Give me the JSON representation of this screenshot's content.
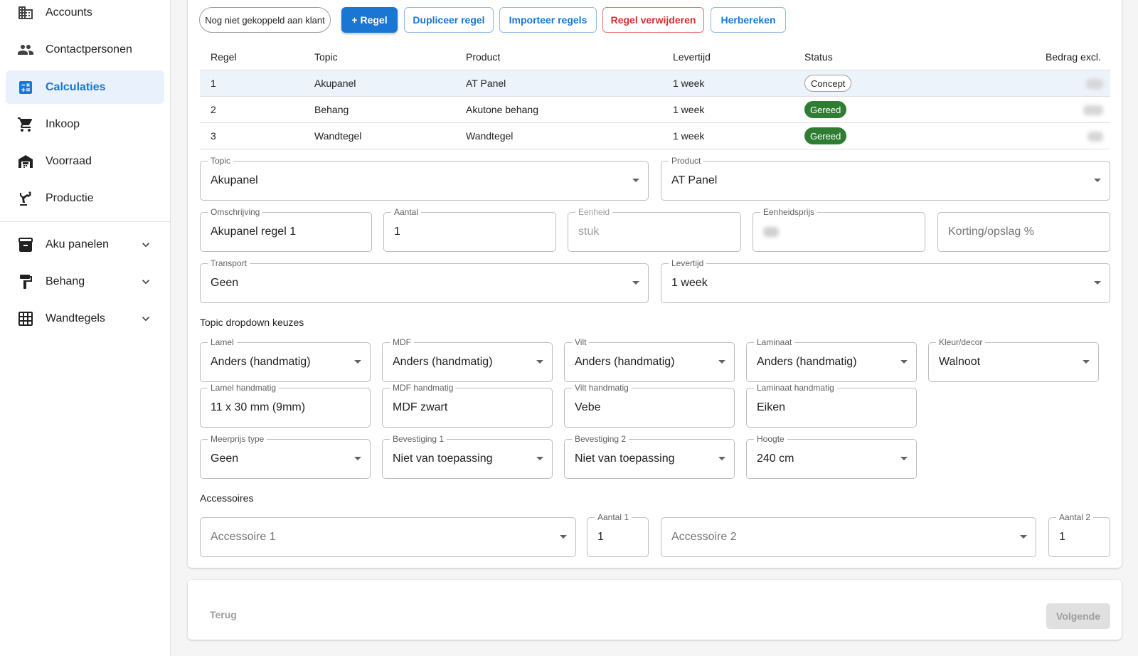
{
  "sidebar": {
    "items": [
      {
        "label": "Accounts",
        "icon": "building-icon"
      },
      {
        "label": "Contactpersonen",
        "icon": "people-icon"
      },
      {
        "label": "Calculaties",
        "icon": "calculator-icon",
        "active": true
      },
      {
        "label": "Inkoop",
        "icon": "cart-icon"
      },
      {
        "label": "Voorraad",
        "icon": "warehouse-icon"
      },
      {
        "label": "Productie",
        "icon": "robot-arm-icon"
      }
    ],
    "groups": [
      {
        "label": "Aku panelen",
        "icon": "archive-box-icon"
      },
      {
        "label": "Behang",
        "icon": "paint-roller-icon"
      },
      {
        "label": "Wandtegels",
        "icon": "grid-icon"
      }
    ]
  },
  "toolbar": {
    "customer_chip": "Nog niet gekoppeld aan klant",
    "add_rule": "+ Regel",
    "duplicate_rule": "Dupliceer regel",
    "import_rules": "Importeer regels",
    "delete_rule": "Regel verwijderen",
    "recalculate": "Herbereken"
  },
  "table": {
    "headers": {
      "regel": "Regel",
      "topic": "Topic",
      "product": "Product",
      "levertijd": "Levertijd",
      "status": "Status",
      "bedrag": "Bedrag excl."
    },
    "rows": [
      {
        "regel": "1",
        "topic": "Akupanel",
        "product": "AT Panel",
        "levertijd": "1 week",
        "status": "Concept"
      },
      {
        "regel": "2",
        "topic": "Behang",
        "product": "Akutone behang",
        "levertijd": "1 week",
        "status": "Gereed"
      },
      {
        "regel": "3",
        "topic": "Wandtegel",
        "product": "Wandtegel",
        "levertijd": "1 week",
        "status": "Gereed"
      }
    ]
  },
  "form": {
    "topic": {
      "label": "Topic",
      "value": "Akupanel"
    },
    "product": {
      "label": "Product",
      "value": "AT Panel"
    },
    "omschrijving": {
      "label": "Omschrijving",
      "value": "Akupanel regel 1"
    },
    "aantal": {
      "label": "Aantal",
      "value": "1"
    },
    "eenheid": {
      "label": "Eenheid",
      "value": "stuk"
    },
    "eenheidsprijs": {
      "label": "Eenheidsprijs"
    },
    "korting": {
      "placeholder": "Korting/opslag %"
    },
    "transport": {
      "label": "Transport",
      "value": "Geen"
    },
    "levertijd": {
      "label": "Levertijd",
      "value": "1 week"
    }
  },
  "topic_section": {
    "title": "Topic dropdown keuzes",
    "lamel": {
      "label": "Lamel",
      "value": "Anders (handmatig)"
    },
    "mdf": {
      "label": "MDF",
      "value": "Anders (handmatig)"
    },
    "vilt": {
      "label": "Vilt",
      "value": "Anders (handmatig)"
    },
    "laminaat": {
      "label": "Laminaat",
      "value": "Anders (handmatig)"
    },
    "kleur": {
      "label": "Kleur/decor",
      "value": "Walnoot"
    },
    "lamel_hand": {
      "label": "Lamel handmatig",
      "value": "11 x 30 mm (9mm)"
    },
    "mdf_hand": {
      "label": "MDF handmatig",
      "value": "MDF zwart"
    },
    "vilt_hand": {
      "label": "Vilt handmatig",
      "value": "Vebe"
    },
    "laminaat_hand": {
      "label": "Laminaat handmatig",
      "value": "Eiken"
    },
    "meerprijs": {
      "label": "Meerprijs type",
      "value": "Geen"
    },
    "bevestiging1": {
      "label": "Bevestiging 1",
      "value": "Niet van toepassing"
    },
    "bevestiging2": {
      "label": "Bevestiging 2",
      "value": "Niet van toepassing"
    },
    "hoogte": {
      "label": "Hoogte",
      "value": "240 cm"
    }
  },
  "accessoires": {
    "title": "Accessoires",
    "acc1": {
      "placeholder": "Accessoire 1"
    },
    "aantal1": {
      "label": "Aantal 1",
      "value": "1"
    },
    "acc2": {
      "placeholder": "Accessoire 2"
    },
    "aantal2": {
      "label": "Aantal 2",
      "value": "1"
    }
  },
  "footer": {
    "back": "Terug",
    "next": "Volgende"
  },
  "colors": {
    "primary": "#1976d2",
    "success": "#2e7d32",
    "danger": "#d32f2f"
  }
}
